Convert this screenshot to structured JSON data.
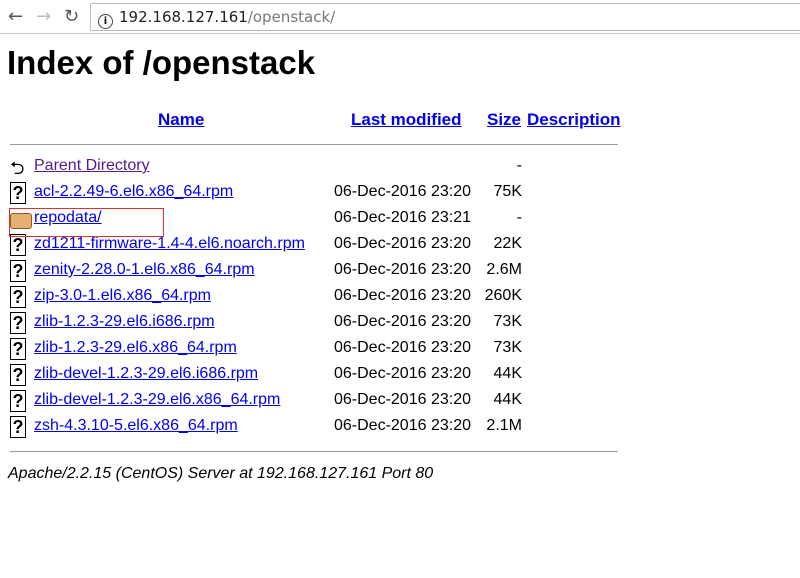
{
  "browser": {
    "url_host": "192.168.127.161",
    "url_path": "/openstack/"
  },
  "page": {
    "title": "Index of /openstack",
    "footer": "Apache/2.2.15 (CentOS) Server at 192.168.127.161 Port 80"
  },
  "columns": {
    "name": "Name",
    "modified": "Last modified",
    "size": "Size",
    "description": "Description"
  },
  "rows": [
    {
      "icon": "back-icon",
      "name": "Parent Directory",
      "date": "",
      "size": "-"
    },
    {
      "icon": "unknown-file-icon",
      "name": "acl-2.2.49-6.el6.x86_64.rpm",
      "date": "06-Dec-2016 23:20",
      "size": "75K"
    },
    {
      "icon": "folder-icon",
      "name": "repodata/",
      "date": "06-Dec-2016 23:21",
      "size": "-"
    },
    {
      "icon": "unknown-file-icon",
      "name": "zd1211-firmware-1.4-4.el6.noarch.rpm",
      "date": "06-Dec-2016 23:20",
      "size": "22K"
    },
    {
      "icon": "unknown-file-icon",
      "name": "zenity-2.28.0-1.el6.x86_64.rpm",
      "date": "06-Dec-2016 23:20",
      "size": "2.6M"
    },
    {
      "icon": "unknown-file-icon",
      "name": "zip-3.0-1.el6.x86_64.rpm",
      "date": "06-Dec-2016 23:20",
      "size": "260K"
    },
    {
      "icon": "unknown-file-icon",
      "name": "zlib-1.2.3-29.el6.i686.rpm",
      "date": "06-Dec-2016 23:20",
      "size": "73K"
    },
    {
      "icon": "unknown-file-icon",
      "name": "zlib-1.2.3-29.el6.x86_64.rpm",
      "date": "06-Dec-2016 23:20",
      "size": "73K"
    },
    {
      "icon": "unknown-file-icon",
      "name": "zlib-devel-1.2.3-29.el6.i686.rpm",
      "date": "06-Dec-2016 23:20",
      "size": "44K"
    },
    {
      "icon": "unknown-file-icon",
      "name": "zlib-devel-1.2.3-29.el6.x86_64.rpm",
      "date": "06-Dec-2016 23:20",
      "size": "44K"
    },
    {
      "icon": "unknown-file-icon",
      "name": "zsh-4.3.10-5.el6.x86_64.rpm",
      "date": "06-Dec-2016 23:20",
      "size": "2.1M"
    }
  ]
}
